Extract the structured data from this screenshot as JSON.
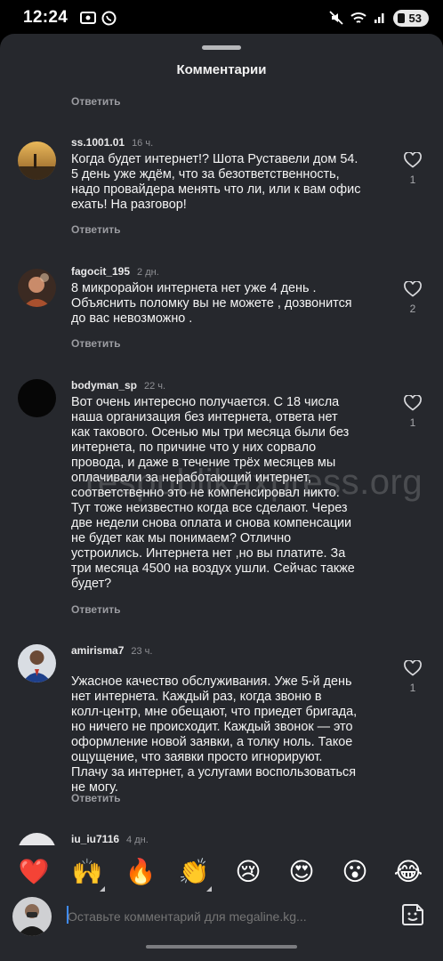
{
  "status_bar": {
    "time": "12:24",
    "battery": "53"
  },
  "sheet": {
    "title": "Комментарии",
    "top_reply": "Ответить"
  },
  "comments": [
    {
      "username": "ss.1001.01",
      "time": "16 ч.",
      "text": "Когда будет интернет!? Шота Руставели дом 54.\n5 день уже ждём, что за безответственность,\nнадо провайдера менять что ли, или к вам офис\nехать! На разговор!",
      "reply": "Ответить",
      "likes": "1"
    },
    {
      "username": "fagocit_195",
      "time": "2 дн.",
      "text": "8 микрорайон интернета нет уже 4 день .\nОбъяснить поломку вы не можете , дозвонится\nдо вас невозможно .",
      "reply": "Ответить",
      "likes": "2"
    },
    {
      "username": "bodyman_sp",
      "time": "22 ч.",
      "text": "Вот очень интересно получается. С 18 числа\nнаша организация без интернета, ответа нет\nкак такового. Осенью мы три месяца были без\nинтернета, по причине что у них сорвало\nпровода, и даже в течение трёх месяцев мы\nоплачивали за неработающий интернет,\nсоответственно это не компенсировал никто.\nТут тоже неизвестно когда все сделают. Через\nдве недели снова оплата и снова компенсации\nне будет как мы понимаем? Отлично\nустроились. Интернета нет ,но вы платите. За\nтри месяца 4500 на воздух ушли. Сейчас также\nбудет?",
      "reply": "Ответить",
      "likes": "1"
    },
    {
      "username": "amirisma7",
      "time": "23 ч.",
      "text": "Ужасное качество обслуживания. Уже 5-й день\nнет интернета. Каждый раз, когда звоню в\nколл-центр, мне обещают, что приедет бригада,\nно ничего не происходит. Каждый звонок — это\nоформление новой заявки, а толку ноль. Такое\nощущение, что заявки просто игнорируют.\nПлачу за интернет, а услугами воспользоваться\nне могу.",
      "reply": "Ответить",
      "likes": "1"
    },
    {
      "username": "iu_iu7116",
      "time": "4 дн."
    }
  ],
  "watermark": "respublikaxpress.org",
  "emoji_bar": [
    "❤️",
    "🙌",
    "🔥",
    "👏",
    "😢",
    "😍",
    "😮",
    "😂"
  ],
  "composer": {
    "placeholder": "Оставьте комментарий для megaline.kg..."
  },
  "icons": {
    "like": "heart-outline-icon",
    "sticker": "sticker-icon"
  }
}
